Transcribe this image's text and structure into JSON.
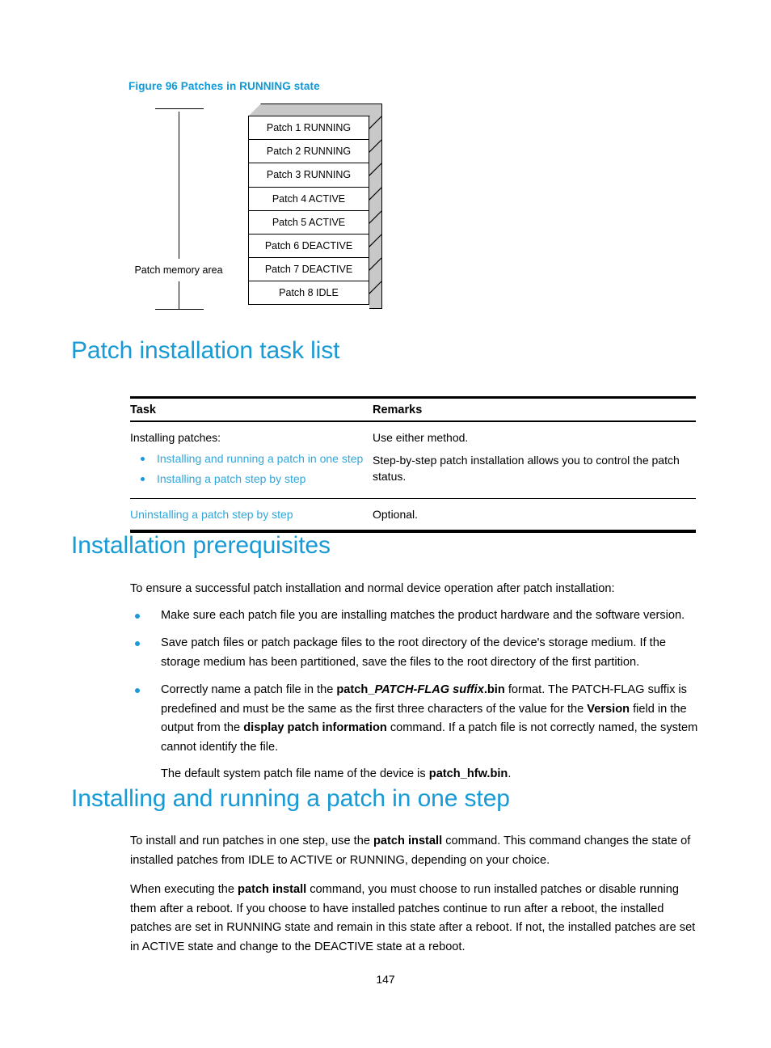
{
  "figure": {
    "caption": "Figure 96 Patches in RUNNING state",
    "bracket_label": "Patch memory area",
    "rows": [
      "Patch 1 RUNNING",
      "Patch 2 RUNNING",
      "Patch 3 RUNNING",
      "Patch 4 ACTIVE",
      "Patch 5 ACTIVE",
      "Patch 6 DEACTIVE",
      "Patch 7 DEACTIVE",
      "Patch 8 IDLE"
    ]
  },
  "headings": {
    "task_list": "Patch installation task list",
    "prerequisites": "Installation prerequisites",
    "one_step": "Installing and running a patch in one step"
  },
  "task_table": {
    "columns": [
      "Task",
      "Remarks"
    ],
    "rows": [
      {
        "task_lead": "Installing patches:",
        "task_links": [
          "Installing and running a patch in one step",
          "Installing a patch step by step"
        ],
        "remarks": [
          "Use either method.",
          "Step-by-step patch installation allows you to control the patch status."
        ]
      },
      {
        "task_link": "Uninstalling a patch step by step",
        "remarks": [
          "Optional."
        ]
      }
    ]
  },
  "prerequisites": {
    "intro": "To ensure a successful patch installation and normal device operation after patch installation:",
    "bullets": [
      {
        "parts": [
          {
            "text": "Make sure each patch file you are installing matches the product hardware and the software version.",
            "style": "normal"
          }
        ]
      },
      {
        "parts": [
          {
            "text": "Save patch files or patch package files to the root directory of the device's storage medium. If the storage medium has been partitioned, save the files to the root directory of the first partition.",
            "style": "normal"
          }
        ]
      },
      {
        "parts": [
          {
            "text": "Correctly name a patch file in the ",
            "style": "normal"
          },
          {
            "text": "patch_",
            "style": "bold"
          },
          {
            "text": "PATCH-FLAG suffix",
            "style": "bold-italic"
          },
          {
            "text": ".bin",
            "style": "bold"
          },
          {
            "text": " format. The PATCH-FLAG suffix is predefined and must be the same as the first three characters of the value for the ",
            "style": "normal"
          },
          {
            "text": "Version",
            "style": "bold"
          },
          {
            "text": " field in the output from the ",
            "style": "normal"
          },
          {
            "text": "display patch information",
            "style": "bold"
          },
          {
            "text": " command. If a patch file is not correctly named, the system cannot identify the file.",
            "style": "normal"
          }
        ]
      }
    ],
    "sub_paragraph": [
      {
        "text": "The default system patch file name of the device is ",
        "style": "normal"
      },
      {
        "text": "patch_hfw.bin",
        "style": "bold"
      },
      {
        "text": ".",
        "style": "normal"
      }
    ]
  },
  "one_step_section": {
    "paragraph_1": [
      {
        "text": "To install and run patches in one step, use the ",
        "style": "normal"
      },
      {
        "text": "patch install",
        "style": "bold"
      },
      {
        "text": " command. This command changes the state of installed patches from IDLE to ACTIVE or RUNNING, depending on your choice.",
        "style": "normal"
      }
    ],
    "paragraph_2": [
      {
        "text": "When executing the ",
        "style": "normal"
      },
      {
        "text": "patch install",
        "style": "bold"
      },
      {
        "text": " command, you must choose to run installed patches or disable running them after a reboot. If you choose to have installed patches continue to run after a reboot, the installed patches are set in RUNNING state and remain in this state after a reboot. If not, the installed patches are set in ACTIVE state and change to the DEACTIVE state at a reboot.",
        "style": "normal"
      }
    ]
  },
  "footer": {
    "page_number": "147"
  },
  "colors": {
    "heading_blue": "#179ad6",
    "caption_blue": "#0f9ad7",
    "link_blue": "#30a7dc",
    "bullet_blue": "#1c9ad8",
    "box_face": "#ffffff",
    "box_shade": "#c8c8c8"
  }
}
